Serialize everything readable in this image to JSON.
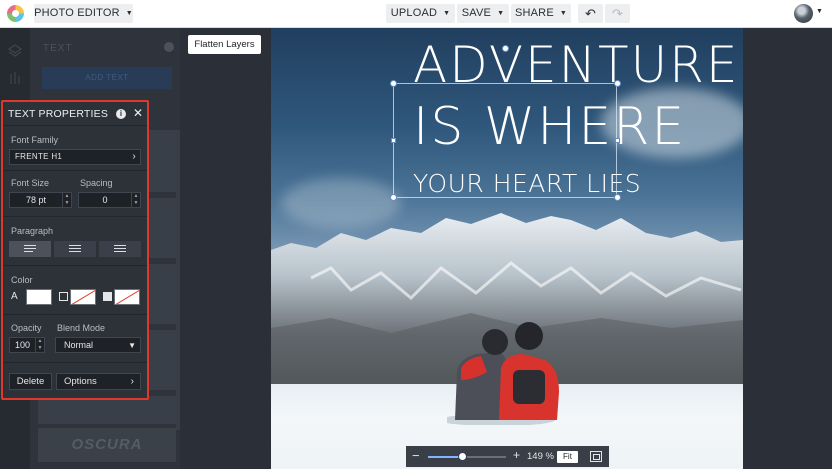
{
  "topbar": {
    "app_menu": "PHOTO EDITOR",
    "upload": "UPLOAD",
    "save": "SAVE",
    "share": "SHARE",
    "undo_icon": "undo-icon",
    "redo_icon": "redo-icon"
  },
  "left_panel": {
    "heading": "TEXT",
    "add_text": "ADD TEXT",
    "preset_label": "OSCURA"
  },
  "flatten_layers": "Flatten Layers",
  "text_properties": {
    "title": "TEXT PROPERTIES",
    "font_family_label": "Font Family",
    "font_family_value": "FRENTE H1",
    "font_size_label": "Font Size",
    "font_size_value": "78 pt",
    "spacing_label": "Spacing",
    "spacing_value": "0",
    "paragraph_label": "Paragraph",
    "paragraph_active": "left",
    "color_label": "Color",
    "text_color_letter": "A",
    "text_color": "#ffffff",
    "opacity_label": "Opacity",
    "opacity_value": "100",
    "blend_mode_label": "Blend Mode",
    "blend_mode_value": "Normal",
    "delete_label": "Delete",
    "options_label": "Options"
  },
  "canvas": {
    "headline_line1": "ADVENTURE",
    "headline_line2": "IS WHERE",
    "headline_line3": "YOUR HEART LIES"
  },
  "zoom": {
    "level": "149 %",
    "level_fraction": 0.45,
    "fit_label": "Fit"
  },
  "colors": {
    "highlight_border": "#e0392b",
    "panel_bg": "#2d3138",
    "accent": "#7fb6ff"
  }
}
